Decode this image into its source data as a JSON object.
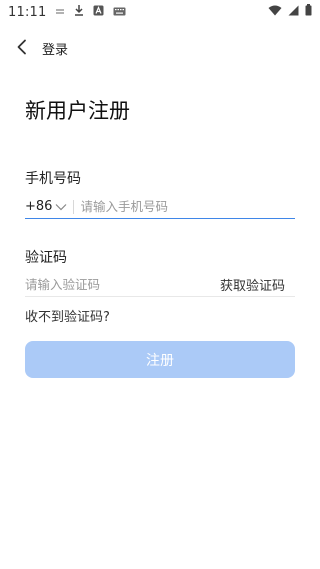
{
  "status_bar": {
    "time": "11:11"
  },
  "header": {
    "title": "登录"
  },
  "page": {
    "title": "新用户注册"
  },
  "phone": {
    "label": "手机号码",
    "country_code": "+86",
    "placeholder": "请输入手机号码"
  },
  "verification": {
    "label": "验证码",
    "placeholder": "请输入验证码",
    "get_code_label": "获取验证码",
    "no_code_link": "收不到验证码?"
  },
  "register_button": {
    "label": "注册"
  },
  "colors": {
    "accent": "#3f86e8",
    "button_disabled": "#abcaf7"
  }
}
